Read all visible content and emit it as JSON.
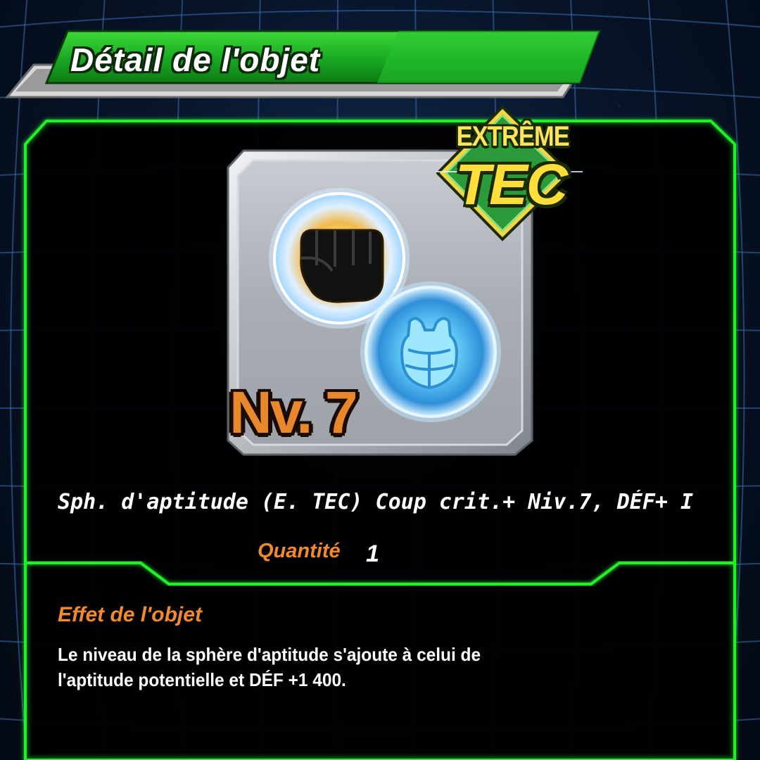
{
  "header": {
    "title": "Détail de l'objet"
  },
  "item": {
    "badge_top": "EXTRÊME",
    "badge_bottom": "TEC",
    "level": "Nv. 7",
    "name": "Sph. d'aptitude (E. TEC) Coup crit.+ Niv.7, DÉF+ I",
    "quantity_label": "Quantité",
    "quantity_value": "1",
    "icons": [
      "fist-icon",
      "armor-icon"
    ]
  },
  "effect": {
    "title": "Effet de l'objet",
    "lines": [
      "Le niveau de la sphère d'aptitude s'ajoute à celui de",
      "l'aptitude potentielle et DÉF +1 400."
    ]
  },
  "colors": {
    "frame_green": "#1ee82a",
    "banner_green": "#18a822",
    "accent_orange": "#f08a2c",
    "badge_yellow": "#ffde3a",
    "background_navy": "#07142a"
  }
}
